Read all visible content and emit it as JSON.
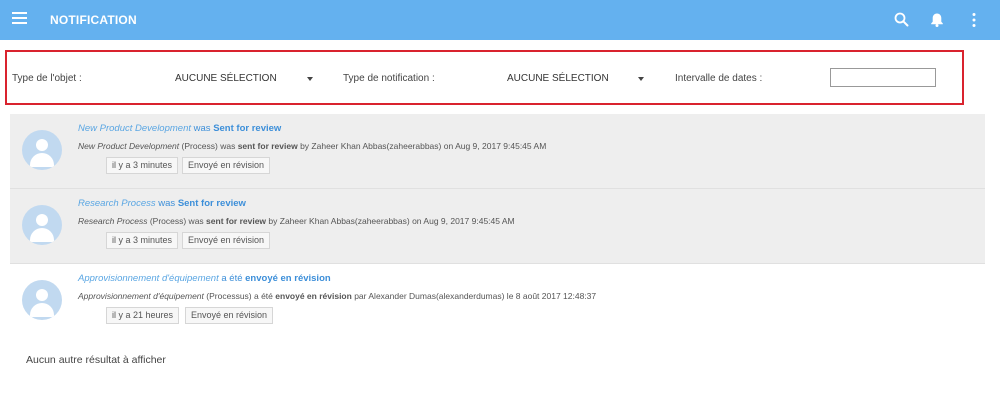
{
  "header": {
    "title": "NOTIFICATION",
    "color": "#64b1ef"
  },
  "icons": {
    "menu": "hamburger-icon",
    "search": "search-icon",
    "bell": "bell-icon",
    "more": "more-vertical-icon"
  },
  "filters": {
    "object_type_label": "Type de l'objet :",
    "object_type_value": "AUCUNE SÉLECTION",
    "notification_type_label": "Type de notification :",
    "notification_type_value": "AUCUNE SÉLECTION",
    "date_range_label": "Intervalle de dates :",
    "date_range_value": ""
  },
  "notifications": [
    {
      "object": "New Product Development",
      "connector": "was",
      "action": "Sent for review",
      "detail_object": "New Product Development",
      "detail_type": "(Process) was",
      "detail_action": "sent for review",
      "detail_rest": "by Zaheer Khan Abbas(zaheerabbas) on Aug 9, 2017 9:45:45 AM",
      "time": "il y a 3 minutes",
      "status": "Envoyé en révision"
    },
    {
      "object": "Research Process",
      "connector": "was",
      "action": "Sent for review",
      "detail_object": "Research Process",
      "detail_type": "(Process) was",
      "detail_action": "sent for review",
      "detail_rest": "by Zaheer Khan Abbas(zaheerabbas) on Aug 9, 2017 9:45:45 AM",
      "time": "il y a 3 minutes",
      "status": "Envoyé en révision"
    },
    {
      "object": "Approvisionnement d'équipement",
      "connector": "a été",
      "action": "envoyé en révision",
      "detail_object": "Approvisionnement d'équipement",
      "detail_type": "(Processus) a été",
      "detail_action": "envoyé en révision",
      "detail_rest": "par Alexander Dumas(alexanderdumas) le 8 août 2017 12:48:37",
      "time": "il y a 21 heures",
      "status": "Envoyé en révision"
    }
  ],
  "footer": {
    "no_more": "Aucun autre résultat à afficher"
  }
}
